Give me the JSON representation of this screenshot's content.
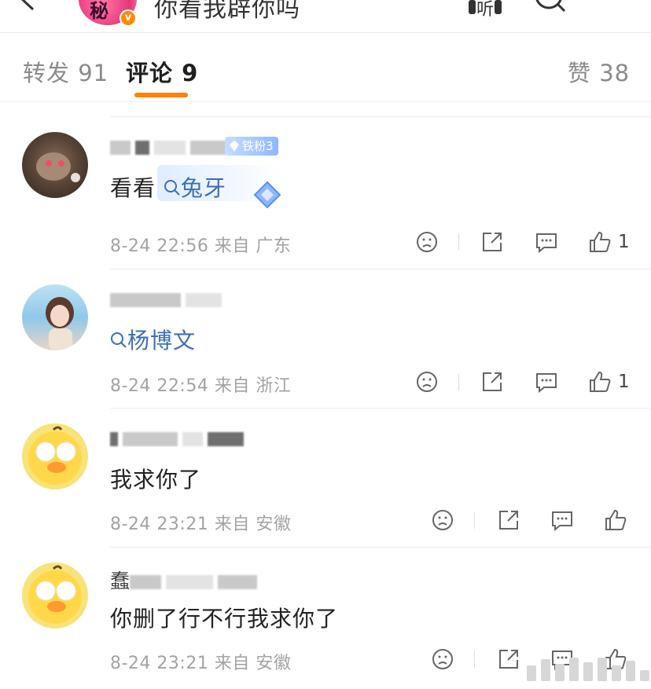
{
  "header": {
    "title": "你看我辟你吗",
    "avatar_text": "秘",
    "verified_icon": "verified-badge-icon",
    "listen_label": "听"
  },
  "tabs": [
    {
      "label": "转发 91"
    },
    {
      "label": "评论 9"
    },
    {
      "label": "赞 38"
    }
  ],
  "comments": [
    {
      "badge": "铁粉3",
      "text_prefix": "看看",
      "link": "兔牙",
      "time": "8-24 22:56",
      "from": "来自 广东",
      "likes": "1"
    },
    {
      "link": "杨博文",
      "time": "8-24 22:54",
      "from": "来自 浙江",
      "likes": "1"
    },
    {
      "text": "我求你了",
      "time": "8-24 23:21",
      "from": "来自 安徽",
      "likes": ""
    },
    {
      "name_visible": "蠢",
      "text": "你删了行不行我求你了",
      "time": "8-24 23:21",
      "from": "来自 安徽",
      "likes": ""
    }
  ],
  "colors": {
    "accent": "#ff8200",
    "link": "#3c6fb5",
    "muted": "#a3a3a3"
  }
}
